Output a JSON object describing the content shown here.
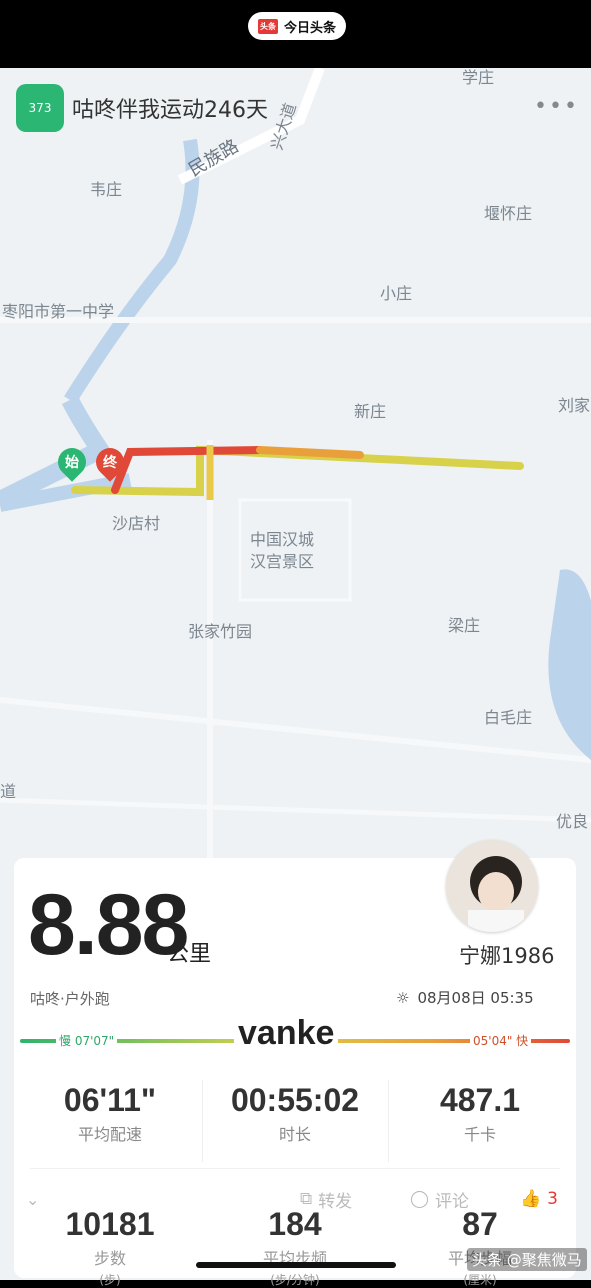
{
  "source_bar": {
    "logo": "头条",
    "name": "今日头条"
  },
  "app": {
    "icon_text": "373",
    "title": "咕咚伴我运动246天"
  },
  "map": {
    "labels": [
      {
        "text": "民族路",
        "key": "minzu"
      },
      {
        "text": "韦庄",
        "key": "weizhuang"
      },
      {
        "text": "堰怀庄",
        "key": "yanhuai"
      },
      {
        "text": "枣阳市第一中学",
        "key": "school"
      },
      {
        "text": "小庄",
        "key": "xiaozhuang"
      },
      {
        "text": "新庄",
        "key": "xinzhuang"
      },
      {
        "text": "刘家",
        "key": "liujia"
      },
      {
        "text": "沙店村",
        "key": "shadian"
      },
      {
        "text": "中国汉城",
        "key": "hancheng"
      },
      {
        "text": "汉宫景区",
        "key": "hangong"
      },
      {
        "text": "张家竹园",
        "key": "zhangjia"
      },
      {
        "text": "梁庄",
        "key": "liangzhuang"
      },
      {
        "text": "白毛庄",
        "key": "baimao"
      },
      {
        "text": "优良",
        "key": "youliang"
      },
      {
        "text": "道",
        "key": "dao_left"
      },
      {
        "text": "学庄",
        "key": "xuezhuang"
      },
      {
        "text": "兴大道",
        "key": "xingdadao"
      }
    ],
    "start_pin": "始",
    "end_pin": "终"
  },
  "summary": {
    "distance": "8.88",
    "unit": "公里",
    "username": "宁娜1986",
    "sport_type": "咕咚·户外跑",
    "datetime": "08月08日 05:35",
    "pace_slow": "慢 07'07\"",
    "pace_fast": "05'04\" 快",
    "watermark": "vanke"
  },
  "stats": [
    {
      "value": "06'11\"",
      "label": "平均配速"
    },
    {
      "value": "00:55:02",
      "label": "时长"
    },
    {
      "value": "487.1",
      "label": "千卡"
    }
  ],
  "stats2": [
    {
      "value": "10181",
      "label": "步数",
      "sub": "(步)"
    },
    {
      "value": "184",
      "label": "平均步频",
      "sub": "(步/分钟)"
    },
    {
      "value": "87",
      "label": "平均步幅",
      "sub": "(厘米)"
    }
  ],
  "overlay": {
    "share": "转发",
    "comment": "评论",
    "like_count": "3",
    "source_mark": "头条 @聚焦微马"
  },
  "colors": {
    "accent": "#2bb673",
    "slow": "#2fa86a",
    "fast": "#d0502a",
    "like": "#e53935"
  }
}
